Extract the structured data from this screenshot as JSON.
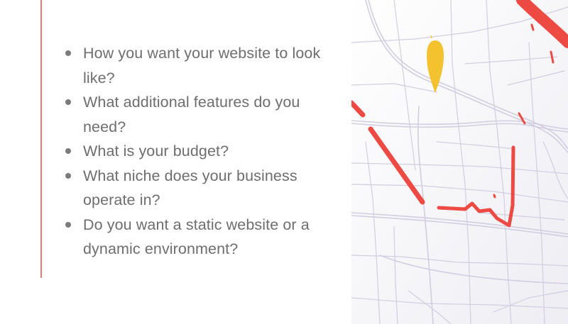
{
  "colors": {
    "accent": "#f07b6b",
    "text": "#6e6e6e",
    "bullet": "#7a7a7a",
    "route": "#ee4a44",
    "road": "#d2cde0",
    "pin": "#f4c22e",
    "map_bg": "#f5f4f8"
  },
  "questions": [
    "How you want your website to look like?",
    "What additional features do you need?",
    "What is your budget?",
    "What niche does your business operate in?",
    "Do you want a static website or a dynamic environment?"
  ],
  "map": {
    "pin_icon": "location-pin-icon"
  }
}
